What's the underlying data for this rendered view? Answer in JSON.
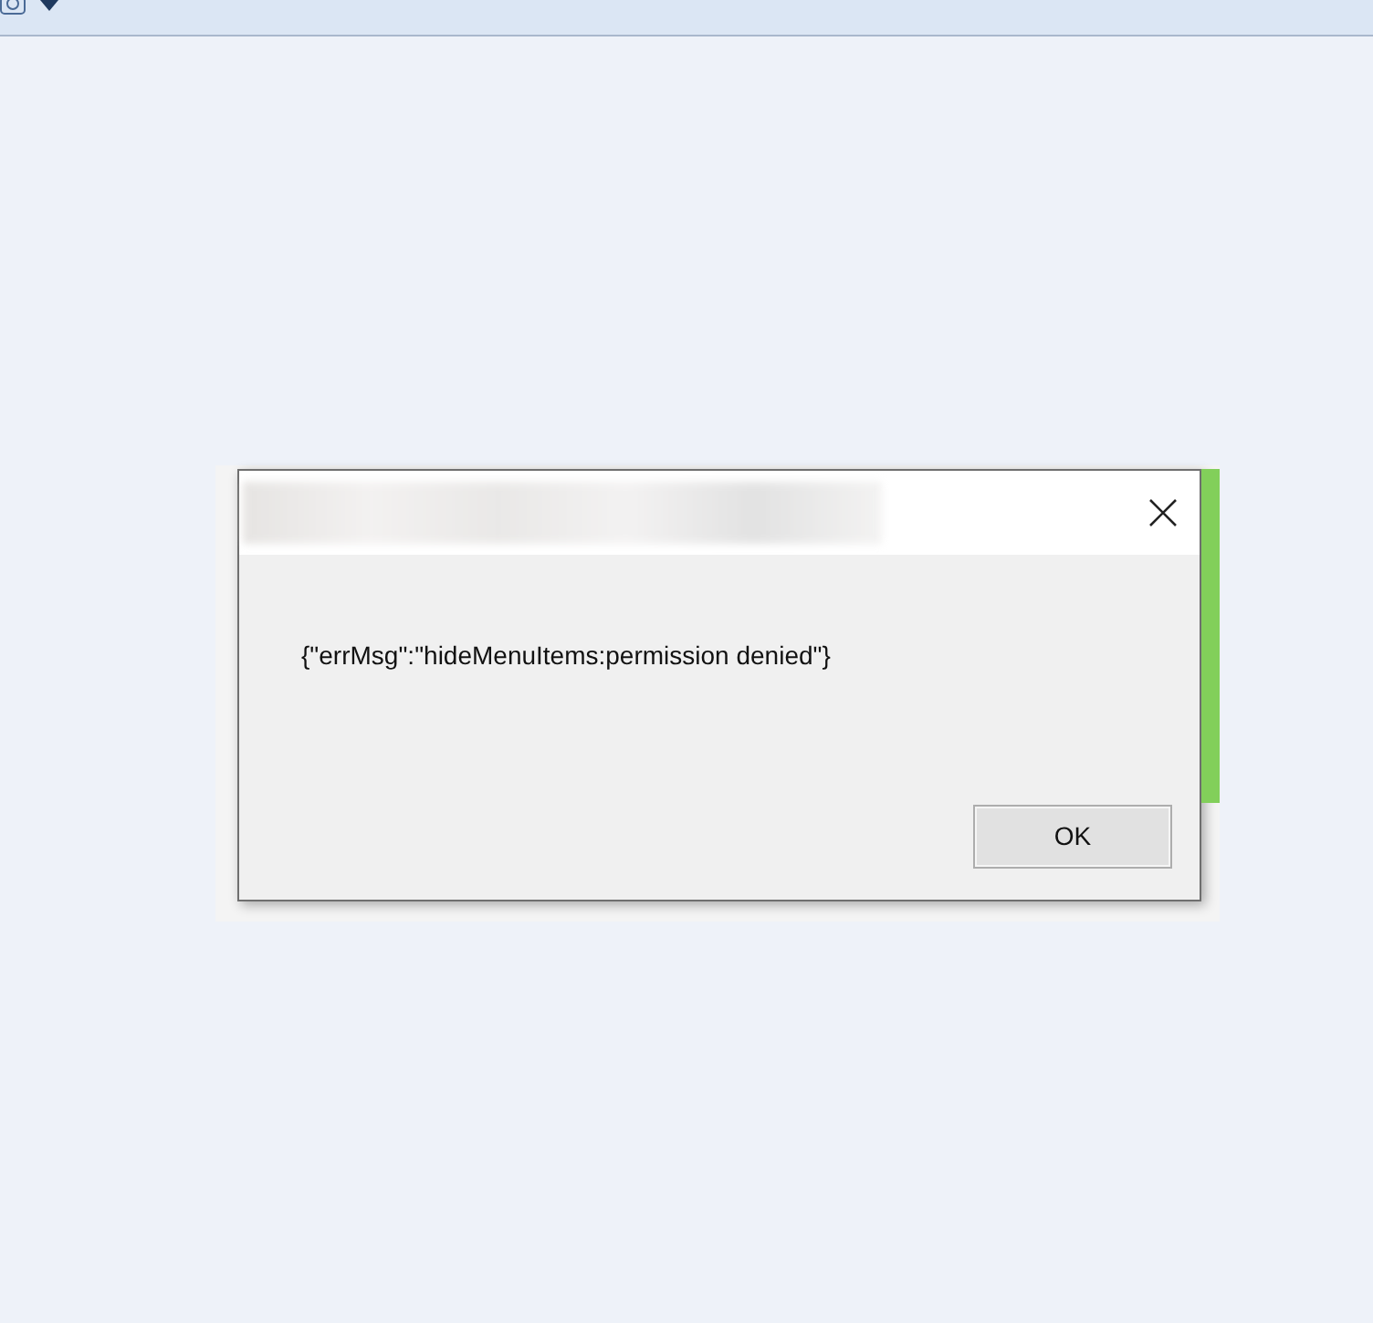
{
  "dialog": {
    "message": "{\"errMsg\":\"hideMenuItems:permission denied\"}",
    "buttons": [
      "OK"
    ]
  }
}
